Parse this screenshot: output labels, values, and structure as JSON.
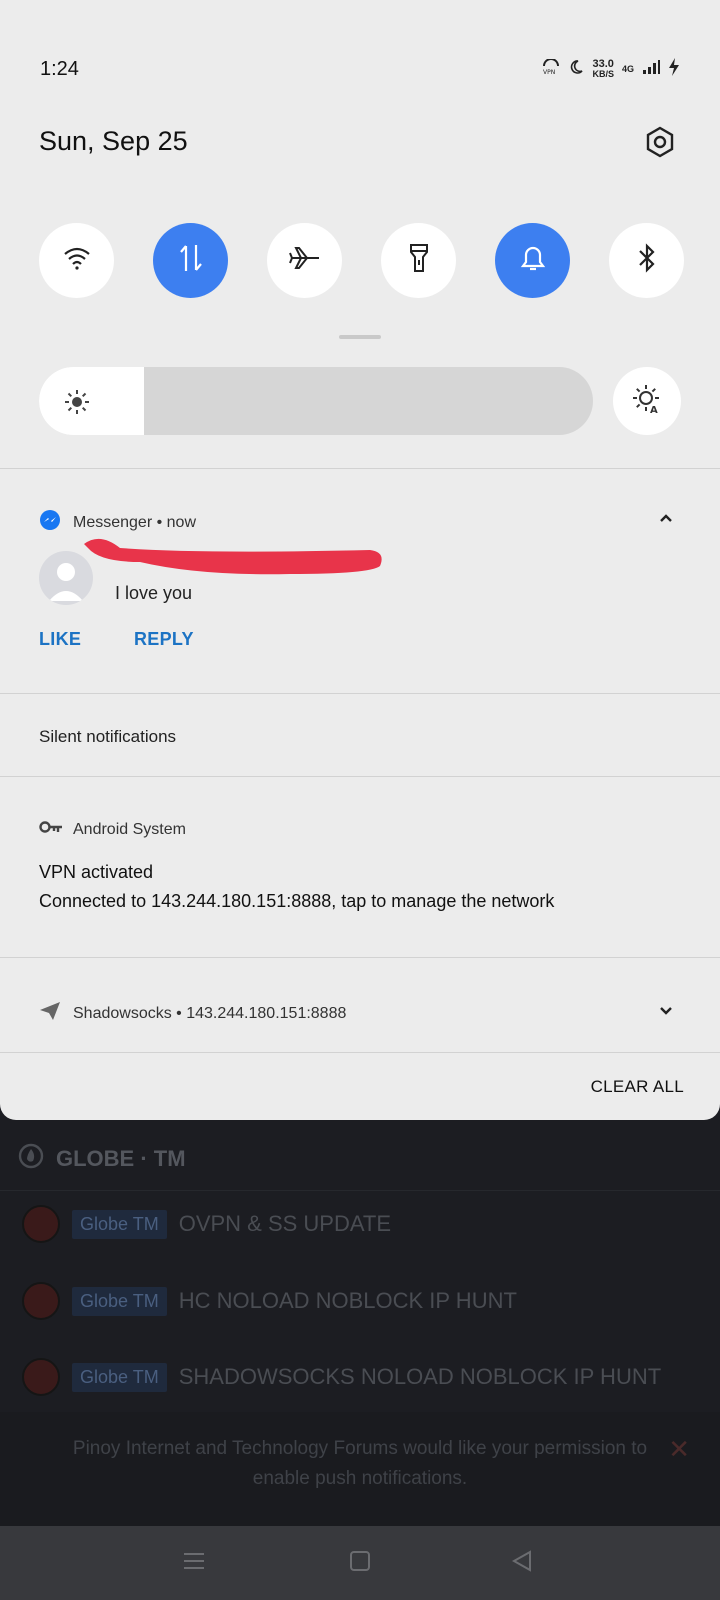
{
  "status_bar": {
    "time": "1:24",
    "speed_value": "33.0",
    "speed_unit": "KB/S",
    "network_type": "4G"
  },
  "header": {
    "date": "Sun, Sep 25"
  },
  "quick_settings": {
    "tiles": [
      {
        "name": "wifi",
        "on": false
      },
      {
        "name": "mobile-data",
        "on": true
      },
      {
        "name": "airplane-mode",
        "on": false
      },
      {
        "name": "flashlight",
        "on": false
      },
      {
        "name": "ring",
        "on": true
      },
      {
        "name": "bluetooth",
        "on": false
      }
    ],
    "brightness_level": 0.19
  },
  "notifications": {
    "messenger": {
      "app": "Messenger",
      "time": "now",
      "message": "I love you",
      "actions": [
        "LIKE",
        "REPLY"
      ]
    },
    "silent_header": "Silent notifications",
    "android_system": {
      "app": "Android System",
      "title": "VPN activated",
      "text": "Connected to 143.244.180.151:8888, tap to manage the network"
    },
    "shadowsocks": {
      "app": "Shadowsocks",
      "detail": "143.244.180.151:8888"
    },
    "clear_all": "CLEAR ALL"
  },
  "background_app": {
    "forum": "GLOBE · TM",
    "threads": [
      {
        "tag": "Globe TM",
        "title": "OVPN & SS UPDATE"
      },
      {
        "tag": "Globe TM",
        "title": "HC NOLOAD NOBLOCK IP HUNT"
      },
      {
        "tag": "Globe TM",
        "title": "SHADOWSOCKS NOLOAD NOBLOCK IP HUNT"
      }
    ],
    "push_prompt": "Pinoy Internet and Technology Forums would like your permission to enable push notifications."
  },
  "colors": {
    "accent": "#3d7ff0",
    "action_text": "#1c73c4",
    "messenger": "#1877f2"
  }
}
